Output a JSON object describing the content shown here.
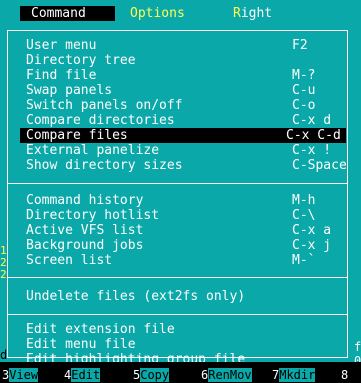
{
  "menubar": {
    "command": "Command",
    "options": "Options",
    "right": "Right"
  },
  "menu": {
    "group1": [
      {
        "label": "User menu",
        "key": "F2"
      },
      {
        "label": "Directory tree",
        "key": ""
      },
      {
        "label": "Find file",
        "key": "M-?"
      },
      {
        "label": "Swap panels",
        "key": "C-u"
      },
      {
        "label": "Switch panels on/off",
        "key": "C-o"
      },
      {
        "label": "Compare directories",
        "key": "C-x d"
      },
      {
        "label": "Compare files",
        "key": "C-x C-d"
      },
      {
        "label": "External panelize",
        "key": "C-x !"
      },
      {
        "label": "Show directory sizes",
        "key": "C-Space"
      }
    ],
    "group2": [
      {
        "label": "Command history",
        "key": "M-h"
      },
      {
        "label": "Directory hotlist",
        "key": "C-\\"
      },
      {
        "label": "Active VFS list",
        "key": "C-x a"
      },
      {
        "label": "Background jobs",
        "key": "C-x j"
      },
      {
        "label": "Screen list",
        "key": "M-`"
      }
    ],
    "group3": [
      {
        "label": "Undelete files (ext2fs only)",
        "key": ""
      }
    ],
    "group4": [
      {
        "label": "Edit extension file",
        "key": ""
      },
      {
        "label": "Edit menu file",
        "key": ""
      },
      {
        "label": "Edit highlighting group file",
        "key": ""
      }
    ]
  },
  "function_keys": [
    {
      "num": "3",
      "label": "View"
    },
    {
      "num": "4",
      "label": "Edit"
    },
    {
      "num": "5",
      "label": "Copy"
    },
    {
      "num": "6",
      "label": "RenMov"
    },
    {
      "num": "7",
      "label": "Mkdir"
    },
    {
      "num": "8",
      "label": ""
    }
  ],
  "left_edge": {
    "ch1": "d",
    "ch2": "1",
    "ch3": "2",
    "ch4": "2"
  },
  "right_edge": {
    "ch1": "f",
    "ch2": "0"
  }
}
